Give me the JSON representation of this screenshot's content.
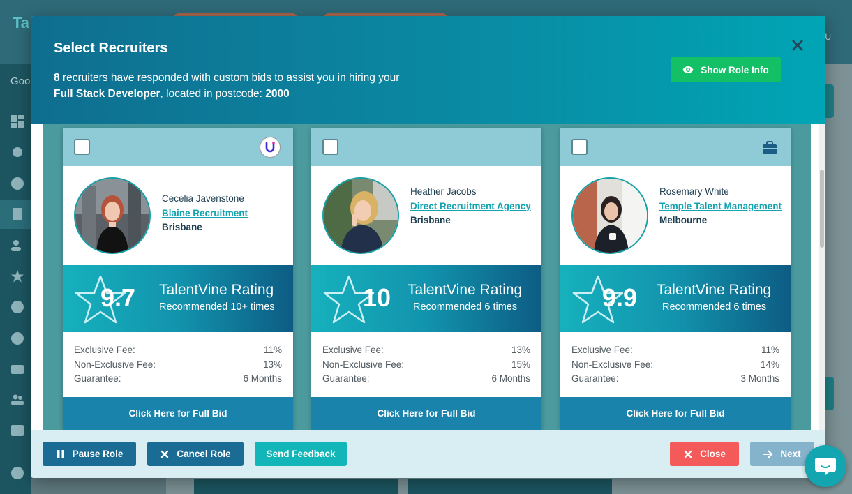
{
  "background": {
    "logo": "Ta",
    "greeting": "Goo",
    "user_initial": "U"
  },
  "modal": {
    "title": "Select Recruiters",
    "subtitle": {
      "count": "8",
      "text1": " recruiters have responded with custom bids to assist you in hiring your ",
      "role": "Full Stack Developer",
      "text2": ", located in postcode: ",
      "postcode": "2000"
    },
    "show_role_info_label": "Show Role Info"
  },
  "recruiters": [
    {
      "name": "Cecelia Javenstone",
      "agency": "Blaine Recruitment",
      "city": "Brisbane",
      "score": "9.7",
      "rating_label": "TalentVine Rating",
      "recommended": "Recommended 10+ times",
      "fees": [
        {
          "label": "Exclusive Fee:",
          "value": "11%"
        },
        {
          "label": "Non-Exclusive Fee:",
          "value": "13%"
        },
        {
          "label": "Guarantee:",
          "value": "6 Months"
        }
      ],
      "full_bid_label": "Click Here for Full Bid",
      "badge_icon": "agency-logo-icon"
    },
    {
      "name": "Heather Jacobs",
      "agency": "Direct Recruitment Agency",
      "city": "Brisbane",
      "score": "10",
      "rating_label": "TalentVine Rating",
      "recommended": "Recommended 6 times",
      "fees": [
        {
          "label": "Exclusive Fee:",
          "value": "13%"
        },
        {
          "label": "Non-Exclusive Fee:",
          "value": "15%"
        },
        {
          "label": "Guarantee:",
          "value": "6 Months"
        }
      ],
      "full_bid_label": "Click Here for Full Bid",
      "badge_icon": ""
    },
    {
      "name": "Rosemary White",
      "agency": "Temple Talent Management",
      "city": "Melbourne",
      "score": "9.9",
      "rating_label": "TalentVine Rating",
      "recommended": "Recommended 6 times",
      "fees": [
        {
          "label": "Exclusive Fee:",
          "value": "11%"
        },
        {
          "label": "Non-Exclusive Fee:",
          "value": "14%"
        },
        {
          "label": "Guarantee:",
          "value": "3 Months"
        }
      ],
      "full_bid_label": "Click Here for Full Bid",
      "badge_icon": "briefcase-icon"
    }
  ],
  "footer": {
    "pause_label": "Pause Role",
    "cancel_label": "Cancel Role",
    "feedback_label": "Send Feedback",
    "close_label": "Close",
    "next_label": "Next"
  },
  "colors": {
    "header_start": "#0f6e90",
    "header_end": "#00a5b5",
    "accent_green": "#14c066",
    "primary_blue": "#1a6c94",
    "teal": "#12b5b8",
    "danger": "#f45a5a",
    "disabled_blue": "#86b3cc"
  }
}
